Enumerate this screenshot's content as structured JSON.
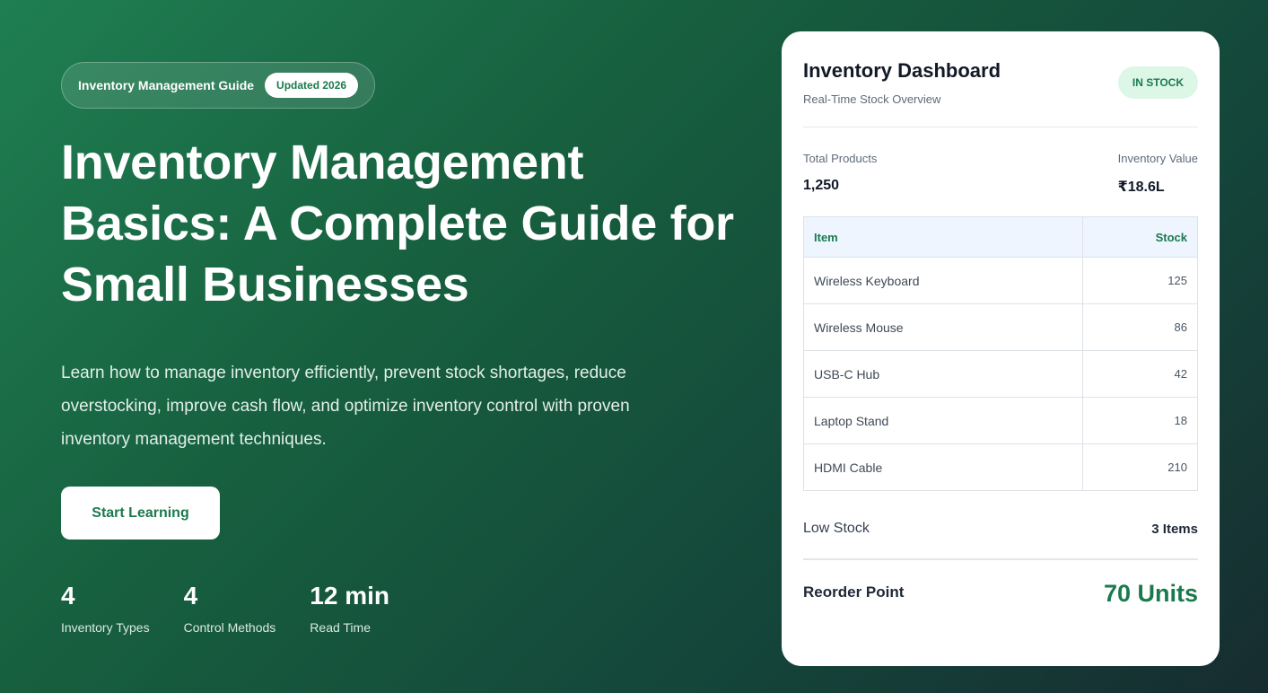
{
  "hero": {
    "pill_label": "Inventory Management Guide",
    "pill_badge": "Updated 2026",
    "title": "Inventory Management Basics: A Complete Guide for Small Businesses",
    "description": "Learn how to manage inventory efficiently, prevent stock shortages, reduce overstocking, improve cash flow, and optimize inventory control with proven inventory management techniques.",
    "cta_label": "Start Learning",
    "stats": [
      {
        "value": "4",
        "label": "Inventory Types"
      },
      {
        "value": "4",
        "label": "Control Methods"
      },
      {
        "value": "12 min",
        "label": "Read Time"
      }
    ]
  },
  "dashboard": {
    "title": "Inventory Dashboard",
    "subtitle": "Real-Time Stock Overview",
    "status_badge": "IN STOCK",
    "metrics": {
      "total_products_label": "Total Products",
      "total_products_value": "1,250",
      "inventory_value_label": "Inventory Value",
      "inventory_value_value": "₹18.6L"
    },
    "table": {
      "headers": [
        "Item",
        "Stock"
      ],
      "rows": [
        [
          "Wireless Keyboard",
          "125"
        ],
        [
          "Wireless Mouse",
          "86"
        ],
        [
          "USB-C Hub",
          "42"
        ],
        [
          "Laptop Stand",
          "18"
        ],
        [
          "HDMI Cable",
          "210"
        ]
      ]
    },
    "low_stock_label": "Low Stock",
    "low_stock_value": "3 Items",
    "reorder_label": "Reorder Point",
    "reorder_value": "70 Units"
  },
  "colors": {
    "accent": "#1b7a4d",
    "badge_bg": "#dcf7e6",
    "table_header_bg": "#eef5ff"
  }
}
